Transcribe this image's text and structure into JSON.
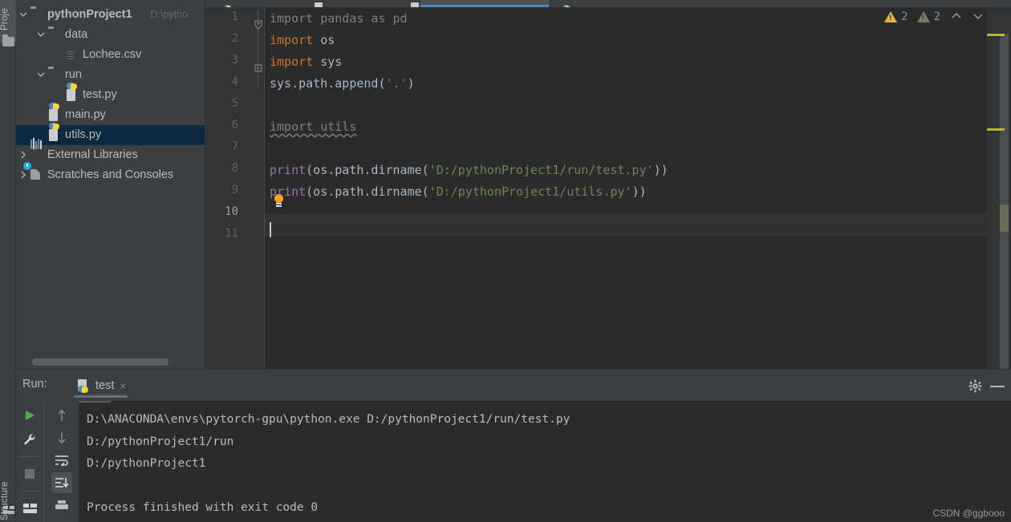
{
  "left_strip": {
    "project_tab": "Proje",
    "structure_tab": "Structure"
  },
  "project_panel": {
    "tree": [
      {
        "label": "pythonProject1",
        "sub": "D:\\pytho",
        "icon": "folder-icon",
        "depth": 0,
        "arrow": "down",
        "bold": true,
        "selected": false
      },
      {
        "label": "data",
        "sub": "",
        "icon": "folder-icon",
        "depth": 1,
        "arrow": "down",
        "bold": false,
        "selected": false
      },
      {
        "label": "Lochee.csv",
        "sub": "",
        "icon": "csv-file-icon",
        "depth": 2,
        "arrow": "",
        "bold": false,
        "selected": false
      },
      {
        "label": "run",
        "sub": "",
        "icon": "folder-icon",
        "depth": 1,
        "arrow": "down",
        "bold": false,
        "selected": false
      },
      {
        "label": "test.py",
        "sub": "",
        "icon": "python-file-icon",
        "depth": 2,
        "arrow": "",
        "bold": false,
        "selected": false
      },
      {
        "label": "main.py",
        "sub": "",
        "icon": "python-file-icon",
        "depth": 1,
        "arrow": "",
        "bold": false,
        "selected": false
      },
      {
        "label": "utils.py",
        "sub": "",
        "icon": "python-file-icon",
        "depth": 1,
        "arrow": "",
        "bold": false,
        "selected": true
      },
      {
        "label": "External Libraries",
        "sub": "",
        "icon": "libraries-icon",
        "depth": 0,
        "arrow": "right",
        "bold": false,
        "selected": false
      },
      {
        "label": "Scratches and Consoles",
        "sub": "",
        "icon": "scratches-icon",
        "depth": 0,
        "arrow": "right",
        "bold": false,
        "selected": false
      }
    ]
  },
  "editor": {
    "line_numbers": [
      "1",
      "2",
      "3",
      "4",
      "5",
      "6",
      "7",
      "8",
      "9",
      "10",
      "11"
    ],
    "current_line": 10,
    "lines": [
      {
        "n": 1,
        "tokens": [
          {
            "t": "import pandas as pd",
            "c": "gray"
          }
        ]
      },
      {
        "n": 2,
        "tokens": [
          {
            "t": "import",
            "c": "kw"
          },
          {
            "t": " os",
            "c": "plain"
          }
        ]
      },
      {
        "n": 3,
        "tokens": [
          {
            "t": "import",
            "c": "kw"
          },
          {
            "t": " sys",
            "c": "plain"
          }
        ]
      },
      {
        "n": 4,
        "tokens": [
          {
            "t": "sys.path.append(",
            "c": "plain"
          },
          {
            "t": "'.'",
            "c": "str"
          },
          {
            "t": ")",
            "c": "plain"
          }
        ]
      },
      {
        "n": 5,
        "tokens": []
      },
      {
        "n": 6,
        "tokens": [
          {
            "t": "import utils",
            "c": "gray wavy"
          }
        ]
      },
      {
        "n": 7,
        "tokens": []
      },
      {
        "n": 8,
        "tokens": [
          {
            "t": "print",
            "c": "fn"
          },
          {
            "t": "(os.path.dirname(",
            "c": "plain"
          },
          {
            "t": "'D:/pythonProject1/run/test.py'",
            "c": "str"
          },
          {
            "t": "))",
            "c": "plain"
          }
        ]
      },
      {
        "n": 9,
        "tokens": [
          {
            "t": "print",
            "c": "fn"
          },
          {
            "t": "(os.path.dirname(",
            "c": "plain"
          },
          {
            "t": "'D:/pythonProject1/utils.py'",
            "c": "str"
          },
          {
            "t": "))",
            "c": "plain"
          }
        ]
      },
      {
        "n": 10,
        "tokens": []
      },
      {
        "n": 11,
        "tokens": []
      }
    ],
    "inspections": {
      "warning_count": "2",
      "weak_warning_count": "2",
      "prev_label": "^",
      "next_label": "v"
    }
  },
  "run_panel": {
    "title": "Run:",
    "tab_name": "test",
    "tab_close": "×",
    "console_lines": [
      "D:\\ANACONDA\\envs\\pytorch-gpu\\python.exe D:/pythonProject1/run/test.py",
      "D:/pythonProject1/run",
      "D:/pythonProject1",
      "",
      "Process finished with exit code 0"
    ],
    "toolbar_left": [
      "run-icon",
      "wrench-icon",
      "stop-icon",
      "layout-icon"
    ],
    "toolbar_right": [
      "arrow-up-icon",
      "arrow-down-icon",
      "soft-wrap-icon",
      "scroll-to-end-icon",
      "print-icon"
    ],
    "gear": "gear-icon",
    "minimize": "minimize-icon"
  },
  "watermark": {
    "text": "CSDN @ggbooo"
  },
  "colors": {
    "editor_bg": "#2b2b2b",
    "panel_bg": "#3c3f41",
    "selection": "#0d293e",
    "keyword": "#cc7832",
    "string": "#6a8759",
    "function": "#9876aa",
    "comment_gray": "#808080",
    "default_text": "#a9b7c6",
    "warning": "#bbb529",
    "tab_accent": "#4a88c7"
  }
}
